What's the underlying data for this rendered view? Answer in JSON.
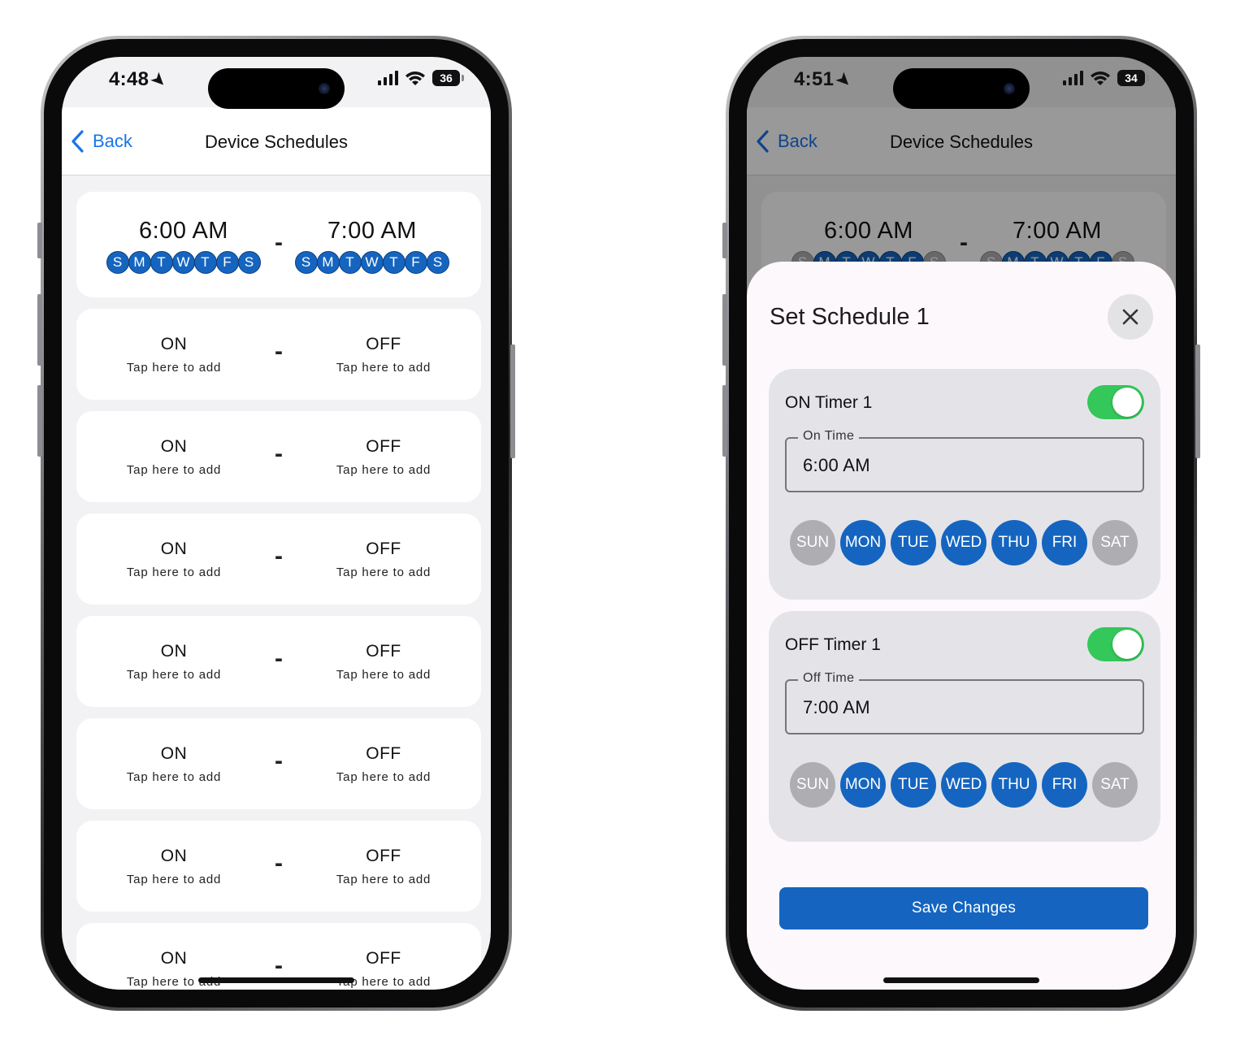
{
  "left_phone": {
    "status": {
      "time": "4:48",
      "battery": "36"
    },
    "nav": {
      "back_label": "Back",
      "title": "Device Schedules"
    },
    "schedule_1": {
      "on_time": "6:00 AM",
      "off_time": "7:00 AM",
      "on_days": [
        "S",
        "M",
        "T",
        "W",
        "T",
        "F",
        "S"
      ],
      "off_days": [
        "S",
        "M",
        "T",
        "W",
        "T",
        "F",
        "S"
      ]
    },
    "empty_slot": {
      "on_label": "ON",
      "off_label": "OFF",
      "hint": "Tap here to add",
      "separator": "-"
    }
  },
  "right_phone": {
    "status": {
      "time": "4:51",
      "battery": "34"
    },
    "nav": {
      "back_label": "Back",
      "title": "Device Schedules"
    },
    "background_schedule": {
      "on_time": "6:00 AM",
      "off_time": "7:00 AM",
      "days": [
        "S",
        "M",
        "T",
        "W",
        "T",
        "F",
        "S"
      ]
    },
    "sheet": {
      "title": "Set Schedule 1",
      "on_timer": {
        "title": "ON Timer 1",
        "enabled": true,
        "field_label": "On Time",
        "field_value": "6:00 AM",
        "days": [
          "SUN",
          "MON",
          "TUE",
          "WED",
          "THU",
          "FRI",
          "SAT"
        ]
      },
      "off_timer": {
        "title": "OFF Timer 1",
        "enabled": true,
        "field_label": "Off Time",
        "field_value": "7:00 AM",
        "days": [
          "SUN",
          "MON",
          "TUE",
          "WED",
          "THU",
          "FRI",
          "SAT"
        ]
      },
      "save_label": "Save Changes"
    }
  },
  "colors": {
    "accent": "#1565c0",
    "link": "#1a73e8",
    "toggle_on": "#34c759",
    "day_off": "#aeaeb2"
  }
}
